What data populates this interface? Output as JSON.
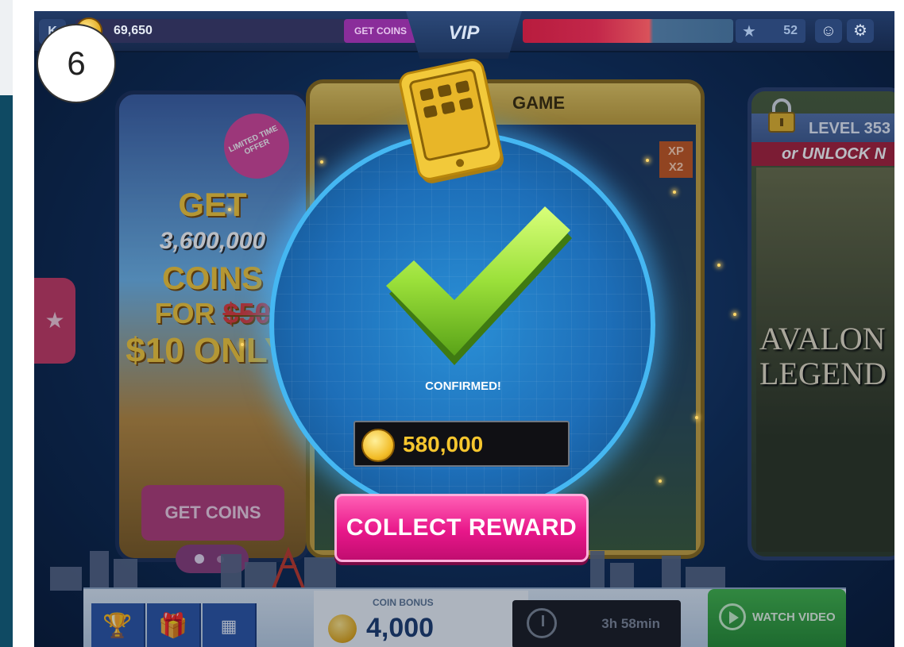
{
  "step_badge": "6",
  "top_bar": {
    "coin_balance": "69,650",
    "get_coins_label": "GET COINS",
    "vip_label": "VIP",
    "xp_progress": 0.62,
    "level": "52"
  },
  "promo_card": {
    "ribbon": "LIMITED TIME OFFER",
    "line1": "GET",
    "line2": "3,600,000",
    "line3": "COINS",
    "line4_prefix": "FOR ",
    "line4_strike": "$50",
    "line5": "$10 ONLY!",
    "button_label": "GET COINS"
  },
  "center_card": {
    "title": "GAME",
    "xp_badge": "XP X2"
  },
  "right_card": {
    "level_label": "LEVEL 353",
    "unlock_label": "or UNLOCK N",
    "game_title": "AVALON\nLEGEND"
  },
  "modal": {
    "status": "CONFIRMED!",
    "reward_amount": "580,000",
    "collect_label": "COLLECT REWARD"
  },
  "bottom_bar": {
    "coin_bonus_label": "COIN BONUS",
    "coin_bonus_value": "4,000",
    "timer": "3h 58min",
    "watch_video_label": "WATCH VIDEO"
  },
  "colors": {
    "accent_pink": "#e8178a",
    "check_green": "#9be03a",
    "circle_blue": "#45b7f2",
    "gold": "#f6c62e"
  }
}
